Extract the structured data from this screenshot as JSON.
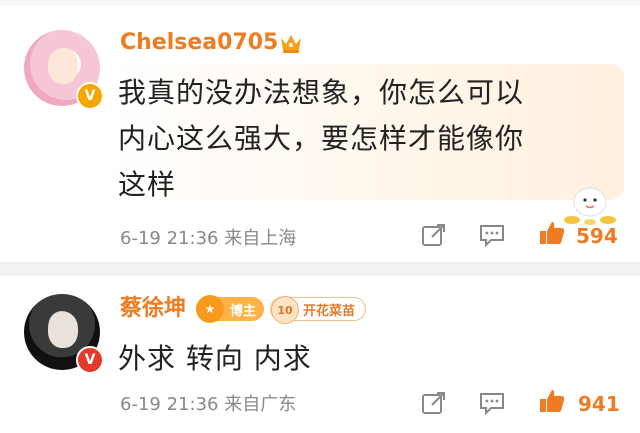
{
  "comments": [
    {
      "username": "Chelsea0705",
      "text_lines": [
        "我真的没办法想象，你怎么可以",
        "内心这么强大，要怎样才能像你",
        "这样"
      ],
      "date": "6-19",
      "time": "21:36",
      "location": "来自上海",
      "likes": "594"
    },
    {
      "username": "蔡徐坤",
      "badges": {
        "host": "博主",
        "fan_level": "10",
        "fan": "开花菜苗"
      },
      "text_lines": [
        "外求 转向 内求"
      ],
      "date": "6-19",
      "time": "21:36",
      "location": "来自广东",
      "likes": "941"
    }
  ],
  "colors": {
    "accent": "#f07b20",
    "meta": "#888888",
    "separator": "#f2f2f2"
  }
}
